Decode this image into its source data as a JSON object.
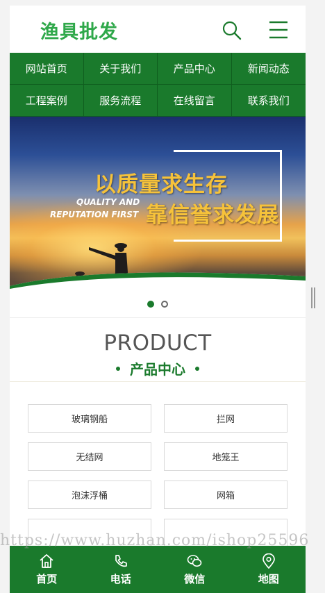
{
  "header": {
    "logo_text": "渔具批发",
    "search_icon": "search-icon",
    "menu_icon": "hamburger-menu-icon"
  },
  "nav": {
    "items": [
      {
        "label": "网站首页"
      },
      {
        "label": "关于我们"
      },
      {
        "label": "产品中心"
      },
      {
        "label": "新闻动态"
      },
      {
        "label": "工程案例"
      },
      {
        "label": "服务流程"
      },
      {
        "label": "在线留言"
      },
      {
        "label": "联系我们"
      }
    ]
  },
  "banner": {
    "title_line1": "以质量求生存",
    "title_line2": "靠信誉求发展",
    "en_line1": "QUALITY AND",
    "en_line2": "REPUTATION FIRST",
    "slide_count": 2,
    "active_slide": 1
  },
  "product_section": {
    "title_en": "PRODUCT",
    "title_cn": "产品中心",
    "items": [
      {
        "label": "玻璃钢船"
      },
      {
        "label": "拦网"
      },
      {
        "label": "无结网"
      },
      {
        "label": "地笼王"
      },
      {
        "label": "泡沫浮桶"
      },
      {
        "label": "网箱"
      },
      {
        "label": ""
      },
      {
        "label": ""
      }
    ]
  },
  "bottom_bar": {
    "items": [
      {
        "label": "首页",
        "icon": "home-icon"
      },
      {
        "label": "电话",
        "icon": "phone-icon"
      },
      {
        "label": "微信",
        "icon": "wechat-icon"
      },
      {
        "label": "地图",
        "icon": "map-pin-icon"
      }
    ]
  },
  "watermark": {
    "text": "https://www.huzhan.com/ishop25596"
  },
  "colors": {
    "brand_green": "#1a7a2c",
    "logo_green": "#2fa84a",
    "banner_gold": "#f6c23a"
  }
}
